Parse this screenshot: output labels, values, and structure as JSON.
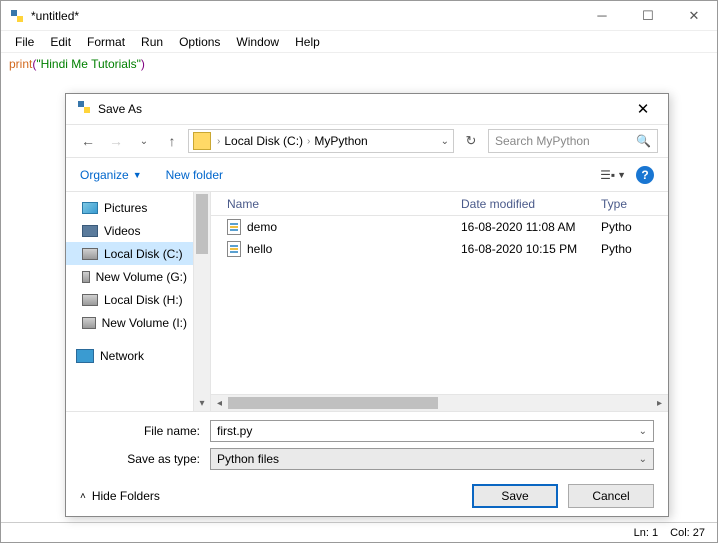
{
  "main_window": {
    "title": "*untitled*",
    "menu": [
      "File",
      "Edit",
      "Format",
      "Run",
      "Options",
      "Window",
      "Help"
    ],
    "code": {
      "keyword": "print",
      "paren_open": "(",
      "string": "\"Hindi Me Tutorials\"",
      "paren_close": ")"
    },
    "status": {
      "ln": "Ln: 1",
      "col": "Col: 27"
    }
  },
  "dialog": {
    "title": "Save As",
    "breadcrumb": {
      "drive": "Local Disk (C:)",
      "folder": "MyPython"
    },
    "search_placeholder": "Search MyPython",
    "toolbar": {
      "organize": "Organize",
      "newfolder": "New folder"
    },
    "sidebar": [
      {
        "label": "Pictures",
        "icon": "ic-pic"
      },
      {
        "label": "Videos",
        "icon": "ic-vid"
      },
      {
        "label": "Local Disk (C:)",
        "icon": "ic-drive",
        "selected": true
      },
      {
        "label": "New Volume (G:)",
        "icon": "ic-drive"
      },
      {
        "label": "Local Disk (H:)",
        "icon": "ic-drive"
      },
      {
        "label": "New Volume (I:)",
        "icon": "ic-drive"
      }
    ],
    "network_label": "Network",
    "columns": {
      "name": "Name",
      "date": "Date modified",
      "type": "Type"
    },
    "files": [
      {
        "name": "demo",
        "date": "16-08-2020 11:08 AM",
        "type": "Pytho"
      },
      {
        "name": "hello",
        "date": "16-08-2020 10:15 PM",
        "type": "Pytho"
      }
    ],
    "filename_label": "File name:",
    "filename_value": "first.py",
    "type_label": "Save as type:",
    "type_value": "Python files",
    "hide_folders": "Hide Folders",
    "save": "Save",
    "cancel": "Cancel"
  }
}
